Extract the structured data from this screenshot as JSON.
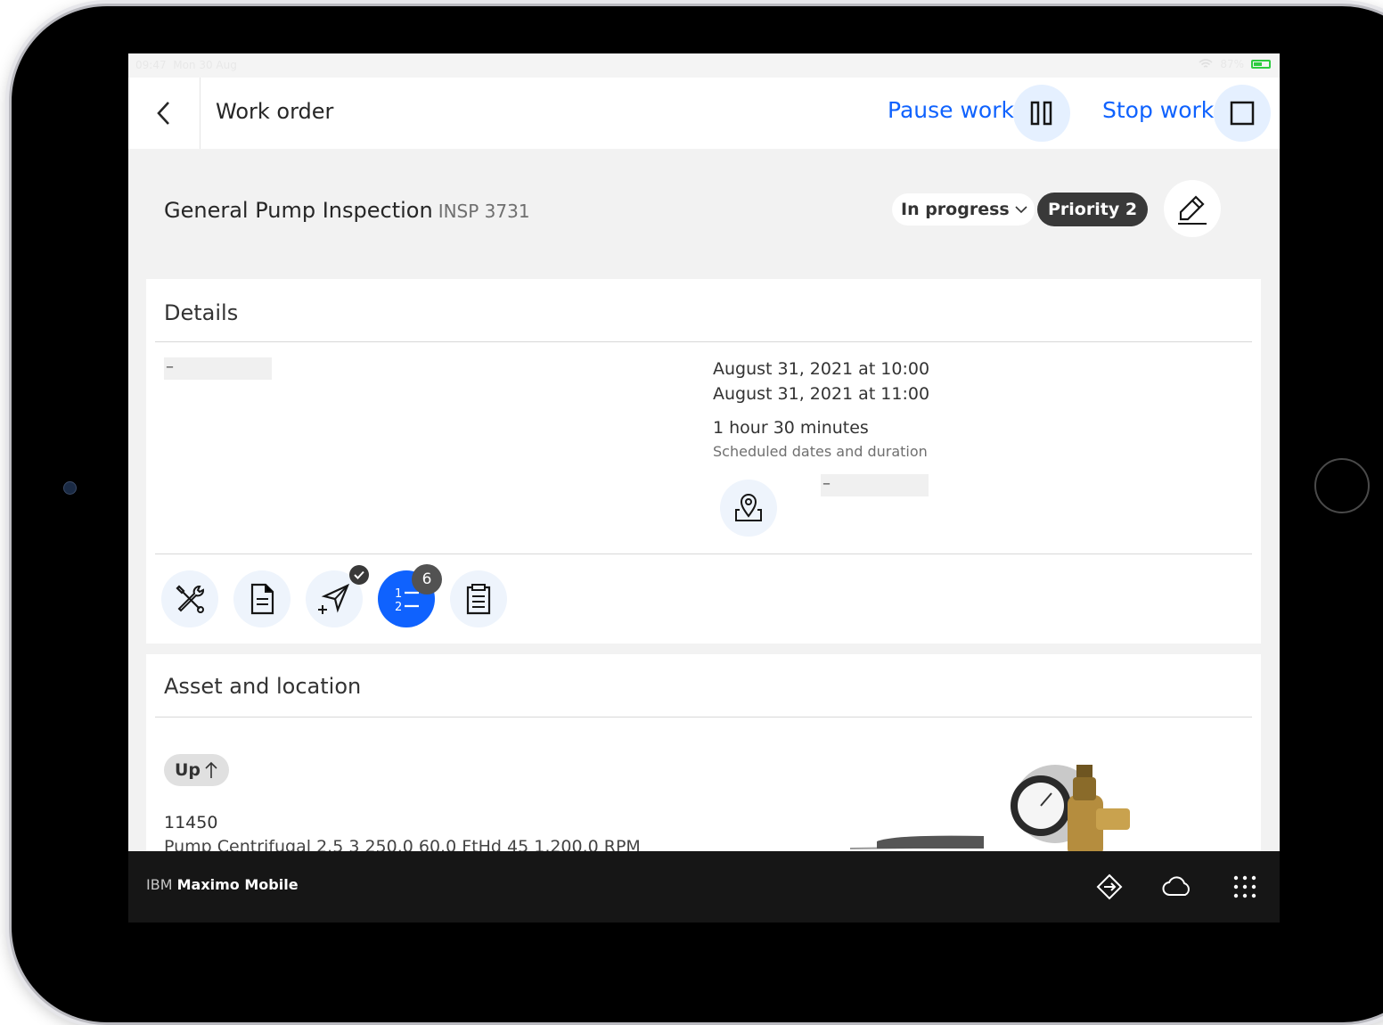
{
  "statusbar": {
    "time": "09:47",
    "date": "Mon 30 Aug",
    "battery": "87%"
  },
  "header": {
    "title": "Work order",
    "pause_label": "Pause work",
    "stop_label": "Stop work"
  },
  "work_order": {
    "title": "General Pump Inspection",
    "id": "INSP 3731",
    "status": "In progress",
    "priority": "Priority 2"
  },
  "details": {
    "title": "Details",
    "description_placeholder": "–",
    "start": "August 31, 2021  at  10:00",
    "end": "August 31, 2021  at  11:00",
    "duration": "1 hour 30 minutes",
    "schedule_label": "Scheduled dates and duration",
    "location_placeholder": "–",
    "tasks_count": "6"
  },
  "asset": {
    "title": "Asset and location",
    "status": "Up",
    "number": "11450",
    "description": "Pump Centrifugal  2.5  3  250.0  60.0 FtHd  45  1,200.0 RPM"
  },
  "footer": {
    "brand_prefix": "IBM",
    "brand_name": "Maximo Mobile"
  },
  "colors": {
    "accent": "#0f62fe",
    "bar": "#161616",
    "priority": "#393939"
  }
}
